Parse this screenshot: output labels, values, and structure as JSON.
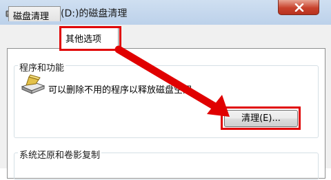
{
  "window": {
    "title": "我的软件(D:)的磁盘清理",
    "close_icon": "close-icon"
  },
  "tabs": [
    {
      "label": "磁盘清理",
      "selected": false
    },
    {
      "label": "其他选项",
      "selected": true
    }
  ],
  "groups": {
    "programs": {
      "label": "程序和功能",
      "description": "可以删除不用的程序以释放磁盘空间。",
      "button_label": "清理(E)...",
      "icon": "programs-features-icon"
    },
    "restore": {
      "label": "系统还原和卷影复制"
    }
  },
  "colors": {
    "annotation": "#e00000",
    "title_bar": "#bcd1ea"
  }
}
